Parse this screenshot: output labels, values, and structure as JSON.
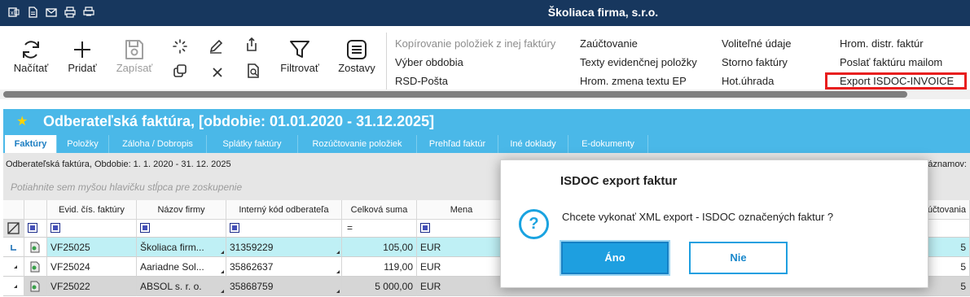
{
  "titlebar": {
    "title": "Školiaca firma, s.r.o.",
    "quick_icons": [
      "excel-icon",
      "document-icon",
      "mail-icon",
      "print-icon",
      "print-preview-icon"
    ]
  },
  "ribbon": {
    "buttons": {
      "reload": "Načítať",
      "add": "Pridať",
      "save": "Zapísať",
      "filter": "Filtrovať",
      "reports": "Zostavy"
    },
    "menu_col1": [
      "Kopírovanie položiek z inej faktúry",
      "Výber obdobia",
      "RSD-Pošta"
    ],
    "menu_col2": [
      "Zaúčtovanie",
      "Texty evidenčnej položky",
      "Hrom. zmena textu EP"
    ],
    "menu_col3": [
      "Voliteľné údaje",
      "Storno faktúry",
      "Hot.úhrada"
    ],
    "menu_col4": [
      "Hrom. distr. faktúr",
      "Poslať faktúru mailom",
      "Export ISDOC-INVOICE"
    ]
  },
  "document": {
    "title": "Odberateľská faktúra, [obdobie: 01.01.2020 - 31.12.2025]",
    "tabs": [
      "Faktúry",
      "Položky",
      "Záloha / Dobropis",
      "Splátky faktúry",
      "Rozúčtovanie položiek",
      "Prehľad faktúr",
      "Iné doklady",
      "E-dokumenty"
    ],
    "info_left": "Odberateľská faktúra, Obdobie: 1. 1. 2020 - 31. 12. 2025",
    "info_right": "záznamov:",
    "group_hint": "Potiahnite sem myšou hlavičku stĺpca pre zoskupenie"
  },
  "grid": {
    "headers": [
      "Evid. čís. faktúry",
      "Názov firmy",
      "Interný kód odberateľa",
      "Celková suma",
      "Mena",
      "účtovania"
    ],
    "rows": [
      {
        "evid": "VF25025",
        "firma": "Školiaca firm...",
        "kod": "31359229",
        "suma": "105,00",
        "mena": "EUR",
        "tail": "5"
      },
      {
        "evid": "VF25024",
        "firma": "Aariadne Sol...",
        "kod": "35862637",
        "suma": "119,00",
        "mena": "EUR",
        "tail": "5"
      },
      {
        "evid": "VF25022",
        "firma": "ABSOL s. r. o.",
        "kod": "35868759",
        "suma": "5 000,00",
        "mena": "EUR",
        "tail": "5"
      }
    ]
  },
  "dialog": {
    "title": "ISDOC export faktur",
    "message": "Chcete vykonať XML export - ISDOC označených faktur  ?",
    "yes": "Áno",
    "no": "Nie"
  }
}
